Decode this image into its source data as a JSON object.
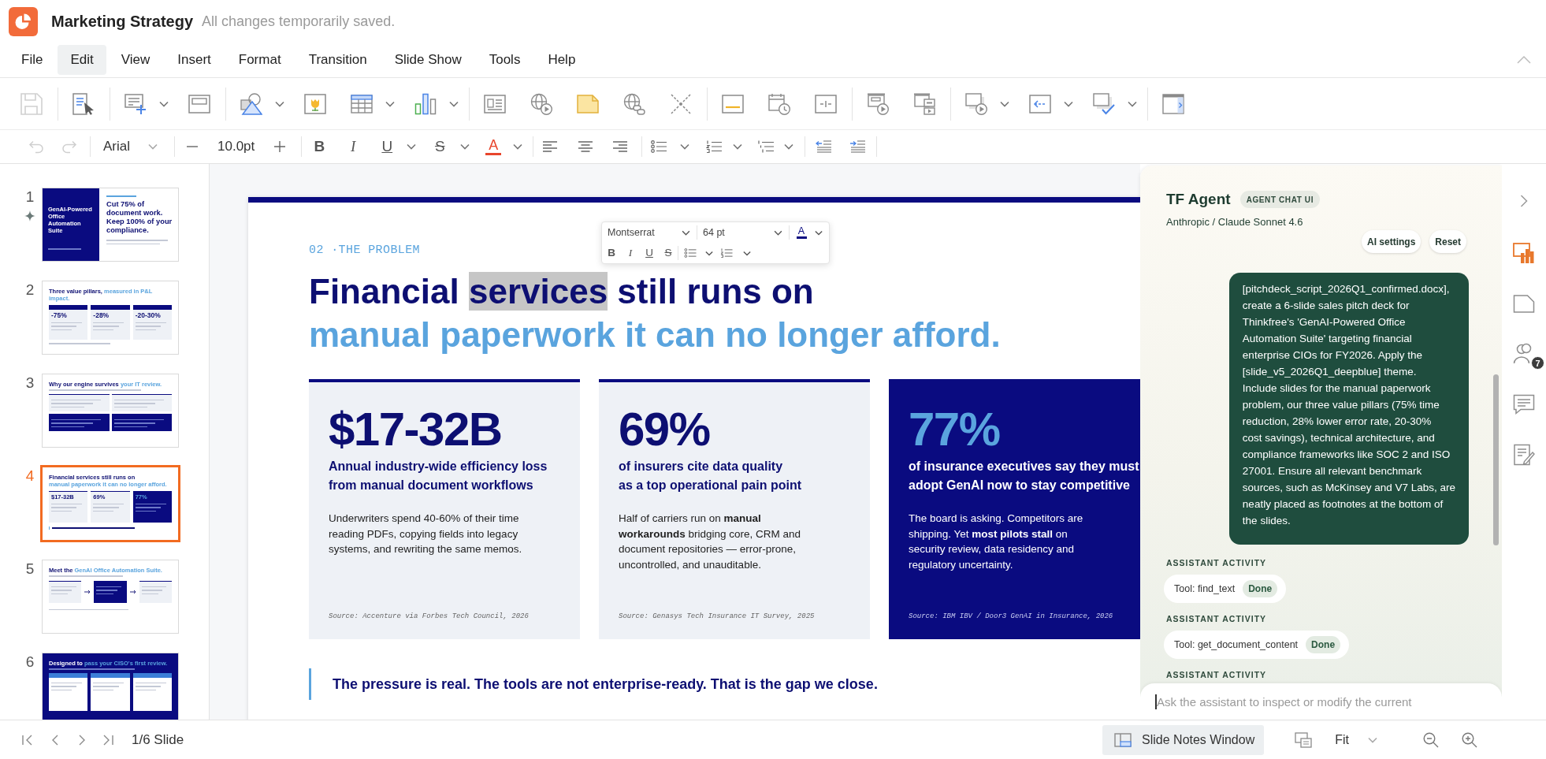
{
  "app": {
    "title": "Marketing Strategy",
    "save_status": "All changes temporarily saved."
  },
  "menu": [
    {
      "label": "File",
      "selected": false
    },
    {
      "label": "Edit",
      "selected": true
    },
    {
      "label": "View",
      "selected": false
    },
    {
      "label": "Insert",
      "selected": false
    },
    {
      "label": "Format",
      "selected": false
    },
    {
      "label": "Transition",
      "selected": false
    },
    {
      "label": "Slide Show",
      "selected": false
    },
    {
      "label": "Tools",
      "selected": false
    },
    {
      "label": "Help",
      "selected": false
    }
  ],
  "toolbar": {
    "save": {
      "disabled": true
    }
  },
  "format_bar": {
    "undo": {
      "disabled": true
    },
    "redo": {
      "disabled": true
    },
    "font": "Arial",
    "size": "10.0pt",
    "styles": [
      {
        "label": "B",
        "kind": "bold"
      },
      {
        "label": "I",
        "kind": "italic"
      },
      {
        "label": "U",
        "kind": "underline"
      },
      {
        "label": "S",
        "kind": "strike"
      }
    ],
    "font_color": {
      "label": "A",
      "color": "#e8452c"
    }
  },
  "thumbnails": [
    {
      "number": "1",
      "selected": false,
      "sparkle": true,
      "kind": "cover",
      "side_title": "GenAI-Powered Office Automation Suite",
      "title": [
        {
          "text": "Cut 75% of document work. Keep 100% of your compliance.",
          "accent": false
        }
      ]
    },
    {
      "number": "2",
      "selected": false,
      "sparkle": false,
      "kind": "pillars",
      "title": [
        {
          "text": "Three value pillars,",
          "accent": false
        },
        {
          "text": "measured in P&L impact.",
          "accent": true
        }
      ],
      "figures": [
        "-75%",
        "-28%",
        "-20-30%"
      ]
    },
    {
      "number": "3",
      "selected": false,
      "sparkle": false,
      "kind": "grid",
      "title": [
        {
          "text": "Why our engine survives",
          "accent": false
        },
        {
          "text": "your IT review.",
          "accent": true
        }
      ]
    },
    {
      "number": "4",
      "selected": true,
      "sparkle": false,
      "kind": "problem",
      "title": [
        {
          "text": "Financial services still runs on",
          "accent": false
        },
        {
          "text": "manual paperwork it can no longer afford.",
          "accent": true
        }
      ],
      "figures": [
        "$17-32B",
        "69%",
        "77%"
      ]
    },
    {
      "number": "5",
      "selected": false,
      "sparkle": false,
      "kind": "flow",
      "title": [
        {
          "text": "Meet the",
          "accent": false
        },
        {
          "text": "GenAI Office Automation Suite.",
          "accent": true
        }
      ]
    },
    {
      "number": "6",
      "selected": false,
      "sparkle": false,
      "kind": "dark",
      "title": [
        {
          "text": "Designed to",
          "accent": false
        },
        {
          "text": "pass your CISO's first review.",
          "accent": true
        }
      ]
    }
  ],
  "slide": {
    "eyebrow": "02 ·THE PROBLEM",
    "heading": {
      "lines": [
        {
          "accent": false,
          "segments": [
            {
              "text": "Financial",
              "highlighted": false
            },
            {
              "text": "services",
              "highlighted": true
            },
            {
              "text": "still runs on",
              "highlighted": false
            }
          ]
        },
        {
          "accent": true,
          "segments": [
            {
              "text": "manual paperwork it can no longer afford.",
              "highlighted": false
            }
          ]
        }
      ]
    },
    "cards": [
      {
        "kind": "light",
        "figure": "$17-32B",
        "subtitle": [
          "Annual industry-wide efficiency loss",
          "from manual document workflows"
        ],
        "body": [
          "Underwriters spend 40-60% of their time",
          "reading PDFs, copying fields into legacy",
          "systems, and rewriting the same memos."
        ],
        "source": "Source: Accenture via Forbes Tech Council, 2026"
      },
      {
        "kind": "light",
        "figure": "69%",
        "subtitle": [
          "of insurers cite **data quality**",
          "as a top operational pain point"
        ],
        "body": [
          "Half of carriers run on **manual**",
          "**workarounds** bridging core, CRM and",
          "document repositories — error-prone,",
          "uncontrolled, and unauditable."
        ],
        "source": "Source: Genasys Tech Insurance IT Survey, 2025"
      },
      {
        "kind": "dark",
        "figure": "77%",
        "subtitle": [
          "of insurance executives say they must",
          "adopt GenAI now to stay competitive"
        ],
        "body": [
          "The board is asking. Competitors are",
          "shipping. Yet **most pilots stall** on",
          "security review, data residency and",
          "regulatory uncertainty."
        ],
        "source": "Source: IBM IBV / Door3 GenAI in Insurance, 2026"
      }
    ],
    "quote": "The pressure is real. The tools are not enterprise-ready. That is the gap we close.",
    "text_popup": {
      "font": "Montserrat",
      "size": "64 pt",
      "font_color": {
        "label": "A",
        "color": "#0a0b80"
      },
      "styles": [
        {
          "label": "B",
          "kind": "bold"
        },
        {
          "label": "I",
          "kind": "italic"
        },
        {
          "label": "U",
          "kind": "underline"
        },
        {
          "label": "S",
          "kind": "strike"
        }
      ]
    }
  },
  "assistant": {
    "title": "TF Agent",
    "badge": "AGENT CHAT UI",
    "model": "Anthropic / Claude Sonnet 4.6",
    "actions": [
      "AI settings",
      "Reset"
    ],
    "message": {
      "lines": [
        "[pitchdeck_script_2026Q1_confirmed.docx],",
        "create a 6-slide sales pitch deck for",
        "Thinkfree's 'GenAI-Powered Office",
        "Automation Suite' targeting financial",
        "enterprise CIOs for FY2026. Apply the",
        "[slide_v5_2026Q1_deepblue] theme.",
        "Include slides for the manual paperwork",
        "problem, our three value pillars (75% time",
        "reduction, 28% lower error rate, 20-30%",
        "cost savings), technical architecture, and",
        "compliance frameworks like SOC 2 and ISO",
        "27001. Ensure all relevant benchmark",
        "sources, such as McKinsey and V7 Labs, are",
        "neatly placed as footnotes at the bottom of",
        "the slides."
      ]
    },
    "activities": [
      {
        "label": "ASSISTANT ACTIVITY",
        "tool": "Tool: find_text",
        "status": "Done"
      },
      {
        "label": "ASSISTANT ACTIVITY",
        "tool": "Tool: get_document_content",
        "status": "Done"
      },
      {
        "label": "ASSISTANT ACTIVITY"
      }
    ],
    "input": {
      "placeholder": "Ask the assistant to inspect or modify the current",
      "focused": true
    }
  },
  "side_rail": [
    {
      "selected": true
    },
    {
      "selected": false
    },
    {
      "selected": false,
      "badge": "7"
    },
    {
      "selected": false
    },
    {
      "selected": false
    }
  ],
  "status_bar": {
    "page": "1/6 Slide",
    "notes": {
      "label": "Slide Notes Window",
      "on": true
    },
    "zoom": "Fit"
  }
}
